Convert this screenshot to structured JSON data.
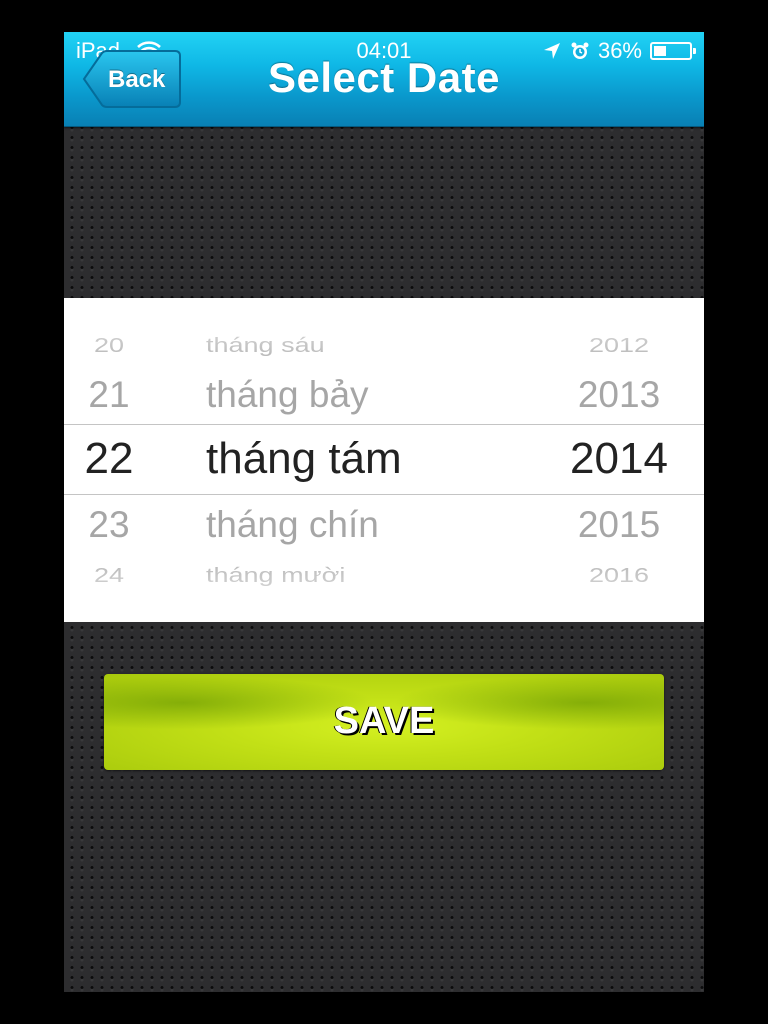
{
  "status_bar": {
    "carrier": "iPad",
    "time": "04:01",
    "battery_text": "36%",
    "battery_level": 0.36,
    "icons": [
      "wifi-icon",
      "location-arrow-icon",
      "alarm-clock-icon",
      "battery-icon"
    ]
  },
  "navbar": {
    "back_label": "Back",
    "title": "Select Date",
    "color": "#0fb8e6"
  },
  "picker": {
    "days": [
      "20",
      "21",
      "22",
      "23",
      "24"
    ],
    "months": [
      "tháng sáu",
      "tháng bảy",
      "tháng tám",
      "tháng chín",
      "tháng mười"
    ],
    "years": [
      "2012",
      "2013",
      "2014",
      "2015",
      "2016"
    ],
    "selected": {
      "day": "22",
      "month": "tháng tám",
      "year": "2014"
    }
  },
  "save_button": {
    "label": "SAVE",
    "color": "#c2e016"
  }
}
